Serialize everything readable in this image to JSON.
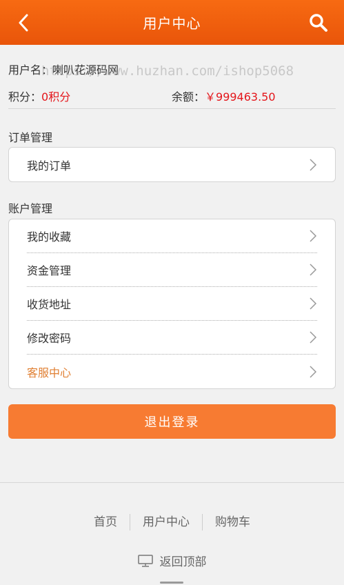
{
  "header": {
    "title": "用户中心",
    "back_icon": "chevron-left-icon",
    "search_icon": "search-icon"
  },
  "user": {
    "name_label": "用户名：",
    "name": "喇叭花源码网",
    "points_label": "积分：",
    "points_value": "0积分",
    "balance_label": "余额：",
    "balance_value": "￥999463.50",
    "watermark": "https://www.huzhan.com/ishop5068"
  },
  "orders_section": {
    "title": "订单管理",
    "items": [
      {
        "label": "我的订单"
      }
    ]
  },
  "account_section": {
    "title": "账户管理",
    "items": [
      {
        "label": "我的收藏"
      },
      {
        "label": "资金管理"
      },
      {
        "label": "收货地址"
      },
      {
        "label": "修改密码"
      },
      {
        "label": "客服中心"
      }
    ]
  },
  "logout_label": "退出登录",
  "footer": {
    "nav": [
      {
        "label": "首页"
      },
      {
        "label": "用户中心"
      },
      {
        "label": "购物车"
      }
    ],
    "back_top": "返回顶部"
  },
  "colors": {
    "accent": "#f76a12",
    "price": "#e4161b",
    "button": "#f77b32",
    "highlight": "#e07f32"
  }
}
